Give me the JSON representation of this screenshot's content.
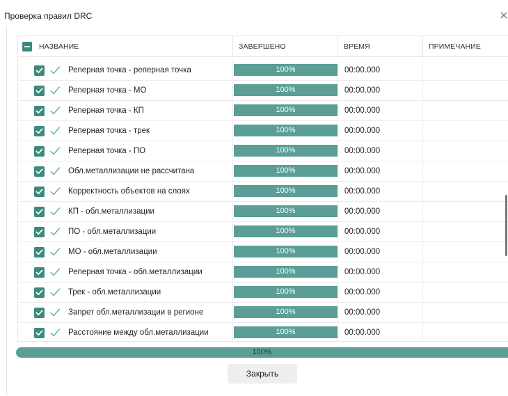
{
  "dialog": {
    "title": "Проверка правил DRC",
    "close_glyph": "✕",
    "close_button_label": "Закрыть"
  },
  "table": {
    "columns": [
      "НАЗВАНИЕ",
      "ЗАВЕРШЕНО",
      "ВРЕМЯ",
      "ПРИМЕЧАНИЕ"
    ],
    "rows": [
      {
        "name": "Реперная точка - реперная точка",
        "done": "100%",
        "time": "00:00.000",
        "note": ""
      },
      {
        "name": "Реперная точка - МО",
        "done": "100%",
        "time": "00:00.000",
        "note": ""
      },
      {
        "name": "Реперная точка - КП",
        "done": "100%",
        "time": "00:00.000",
        "note": ""
      },
      {
        "name": "Реперная точка - трек",
        "done": "100%",
        "time": "00:00.000",
        "note": ""
      },
      {
        "name": "Реперная точка - ПО",
        "done": "100%",
        "time": "00:00.000",
        "note": ""
      },
      {
        "name": "Обл.металлизации не рассчитана",
        "done": "100%",
        "time": "00:00.000",
        "note": ""
      },
      {
        "name": "Корректность объектов на слоях",
        "done": "100%",
        "time": "00:00.000",
        "note": ""
      },
      {
        "name": "КП - обл.металлизации",
        "done": "100%",
        "time": "00:00.000",
        "note": ""
      },
      {
        "name": "ПО - обл.металлизации",
        "done": "100%",
        "time": "00:00.000",
        "note": ""
      },
      {
        "name": "МО - обл.металлизации",
        "done": "100%",
        "time": "00:00.000",
        "note": ""
      },
      {
        "name": "Реперная точка - обл.металлизации",
        "done": "100%",
        "time": "00:00.000",
        "note": ""
      },
      {
        "name": "Трек - обл.металлизации",
        "done": "100%",
        "time": "00:00.000",
        "note": ""
      },
      {
        "name": "Запрет обл.металлизации в регионе",
        "done": "100%",
        "time": "00:00.000",
        "note": ""
      },
      {
        "name": "Расстояние между обл.металлизации",
        "done": "100%",
        "time": "00:00.000",
        "note": ""
      }
    ]
  },
  "overall_progress": {
    "label": "100%",
    "value": 1.0
  },
  "colors": {
    "accent": "#3b8a7e",
    "progress": "#5a9e96",
    "tick": "#6bb19c"
  },
  "icons": {
    "checkbox": "checkbox-checked-icon",
    "status": "success-check-icon",
    "header_checkbox": "collapse-minus-icon",
    "close": "close-icon"
  }
}
